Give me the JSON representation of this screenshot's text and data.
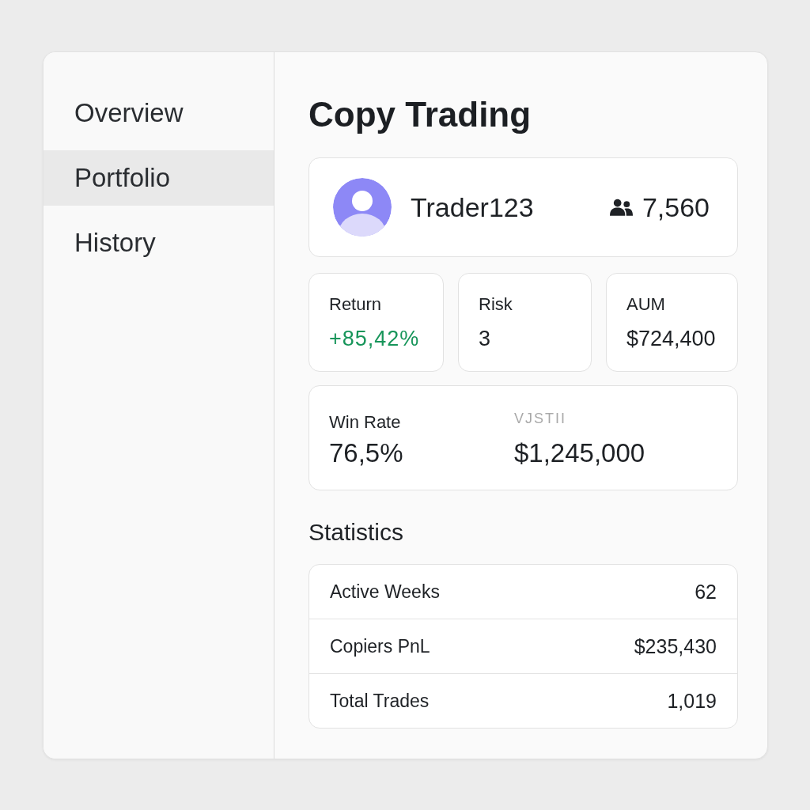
{
  "sidebar": {
    "items": [
      {
        "label": "Overview",
        "selected": false
      },
      {
        "label": "Portfolio",
        "selected": true
      },
      {
        "label": "History",
        "selected": false
      }
    ]
  },
  "title": "Copy Trading",
  "trader": {
    "name": "Trader123",
    "followers": "7,560"
  },
  "metrics": [
    {
      "label": "Return",
      "value": "+85,42%",
      "positive": true
    },
    {
      "label": "Risk",
      "value": "3",
      "positive": false
    },
    {
      "label": "AUM",
      "value": "$724,400",
      "positive": false
    }
  ],
  "summary": [
    {
      "label": "Win Rate",
      "value": "76,5%",
      "dimmed": false
    },
    {
      "label": "VJSTII",
      "value": "$1,245,000",
      "dimmed": true
    }
  ],
  "statistics": {
    "title": "Statistics",
    "rows": [
      {
        "label": "Active Weeks",
        "value": "62"
      },
      {
        "label": "Copiers PnL",
        "value": "$235,430"
      },
      {
        "label": "Total Trades",
        "value": "1,019"
      }
    ]
  }
}
